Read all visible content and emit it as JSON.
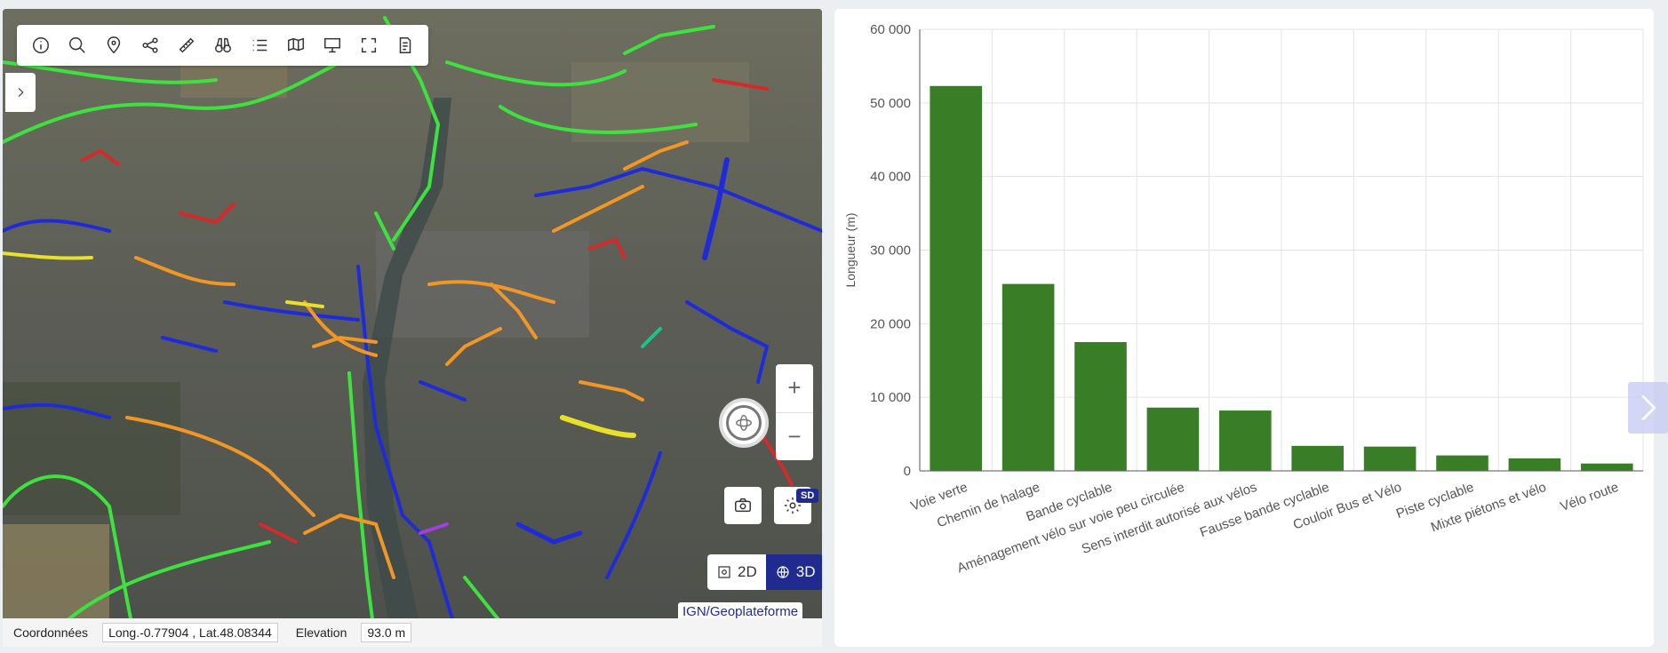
{
  "map": {
    "toolbar": [
      {
        "icon": "info-icon"
      },
      {
        "icon": "search-icon"
      },
      {
        "icon": "location-pin-icon"
      },
      {
        "icon": "share-icon"
      },
      {
        "icon": "ruler-icon"
      },
      {
        "icon": "binoculars-icon"
      },
      {
        "icon": "list-icon"
      },
      {
        "icon": "map-settings-icon"
      },
      {
        "icon": "presentation-icon"
      },
      {
        "icon": "fullscreen-icon"
      },
      {
        "icon": "page-settings-icon"
      }
    ],
    "zoom_in": "+",
    "zoom_out": "−",
    "sd_badge": "SD",
    "mode_2d": "2D",
    "mode_3d": "3D",
    "active_mode": "3D",
    "attribution": "IGN/Geoplateforme",
    "status": {
      "coords_label": "Coordonnées",
      "coords_value": "Long.-0.77904 , Lat.48.08344",
      "elevation_label": "Elevation",
      "elevation_value": "93.0 m"
    }
  },
  "chart_data": {
    "type": "bar",
    "categories": [
      "Voie verte",
      "Chemin de halage",
      "Bande cyclable",
      "Aménagement vélo sur voie peu circulée",
      "Sens interdit autorisé aux vélos",
      "Fausse bande cyclable",
      "Couloir Bus et Vélo",
      "Piste cyclable",
      "Mixte piétons et vélo",
      "Vélo route"
    ],
    "values": [
      52300,
      25400,
      17500,
      8600,
      8200,
      3400,
      3300,
      2100,
      1700,
      1000
    ],
    "ylabel": "Longueur (m)",
    "ylim": [
      0,
      60000
    ],
    "yticks": [
      0,
      10000,
      20000,
      30000,
      40000,
      50000,
      60000
    ],
    "ytick_labels": [
      "0",
      "10 000",
      "20 000",
      "30 000",
      "40 000",
      "50 000",
      "60 000"
    ],
    "grid": true,
    "bar_color": "#3a7d27"
  }
}
